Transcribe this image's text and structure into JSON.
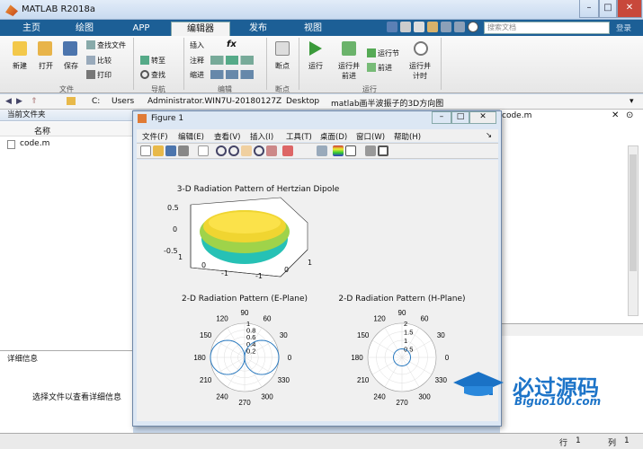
{
  "window": {
    "title": "MATLAB R2018a"
  },
  "tabs": [
    "主页",
    "绘图",
    "APP",
    "编辑器",
    "发布",
    "视图"
  ],
  "search": {
    "placeholder": "搜索文档",
    "login": "登录"
  },
  "ribbon": {
    "new": "新建",
    "open": "打开",
    "save": "保存",
    "find_files": "查找文件",
    "compare": "比较",
    "print": "打印",
    "goto": "转至",
    "find": "查找",
    "insert": "插入",
    "comment": "注释",
    "indent": "缩进",
    "fx": "fx",
    "breakpoints": "断点",
    "run": "运行",
    "run_advance": "运行并\n前进",
    "run_section": "运行节",
    "advance": "前进",
    "run_time": "运行并\n计时",
    "groups": {
      "file": "文件",
      "navigate": "导航",
      "edit": "编辑",
      "breakpoints": "断点",
      "run": "运行"
    }
  },
  "address": {
    "path": [
      "C:",
      "Users",
      "Administrator.WIN7U-20180127Z",
      "Desktop",
      "matlab画半波振子的3D方向图"
    ]
  },
  "left_panel": {
    "title": "当前文件夹",
    "col_name": "名称",
    "files": [
      "code.m"
    ]
  },
  "detail_panel": {
    "title": "详细信息",
    "empty": "选择文件以查看详细信息"
  },
  "right_panel": {
    "tab": "code.m"
  },
  "status": {
    "row_label": "行",
    "row": "1",
    "col_label": "列",
    "col": "1"
  },
  "figure": {
    "title": "Figure 1",
    "menu": [
      "文件(F)",
      "编辑(E)",
      "查看(V)",
      "插入(I)",
      "工具(T)",
      "桌面(D)",
      "窗口(W)",
      "帮助(H)"
    ],
    "plot3d": {
      "title": "3-D Radiation Pattern of Hertzian Dipole",
      "zticks": [
        "0.5",
        "0",
        "-0.5"
      ],
      "xticks": [
        "1",
        "0",
        "-1"
      ],
      "yticks": [
        "-1",
        "0",
        "1"
      ]
    },
    "polarE": {
      "title": "2-D Radiation Pattern (E-Plane)",
      "rticks": [
        "0.2",
        "0.4",
        "0.6",
        "0.8",
        "1"
      ]
    },
    "polarH": {
      "title": "2-D Radiation Pattern (H-Plane)",
      "rticks": [
        "0.5",
        "1",
        "1.5",
        "2"
      ]
    },
    "angles": [
      "90",
      "60",
      "30",
      "0",
      "330",
      "300",
      "270",
      "240",
      "210",
      "180",
      "150",
      "120"
    ]
  },
  "watermark": {
    "cn": "必过源码",
    "en": "Biguo100.com"
  }
}
